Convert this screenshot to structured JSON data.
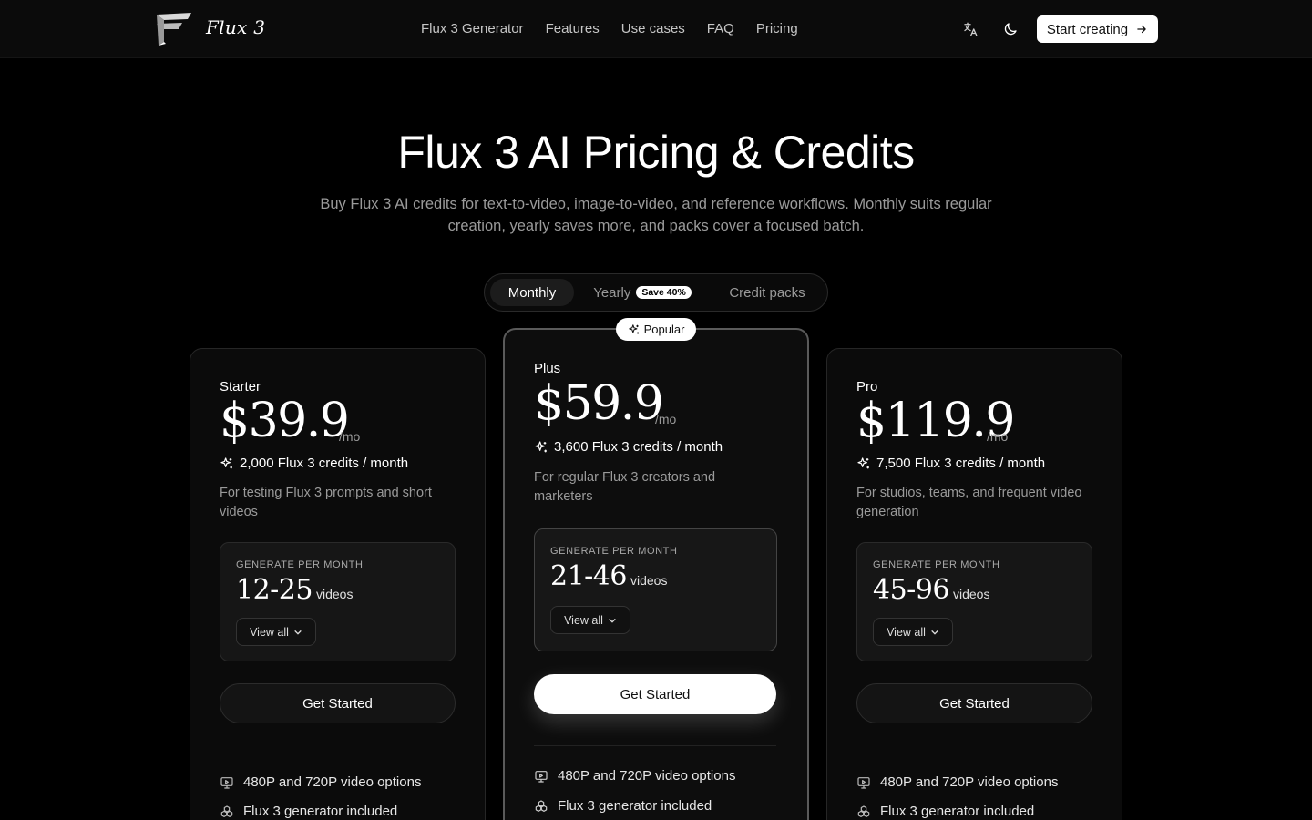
{
  "header": {
    "brand": "Flux 3",
    "nav": [
      "Flux 3 Generator",
      "Features",
      "Use cases",
      "FAQ",
      "Pricing"
    ],
    "cta_label": "Start creating",
    "icons": [
      "translate-icon",
      "moon-icon",
      "arrow-right-icon"
    ]
  },
  "hero": {
    "title": "Flux 3 AI Pricing & Credits",
    "subtitle": "Buy Flux 3 AI credits for text-to-video, image-to-video, and reference workflows. Monthly suits regular creation, yearly saves more, and packs cover a focused batch."
  },
  "billing_toggle": {
    "monthly": "Monthly",
    "yearly": "Yearly",
    "yearly_badge": "Save 40%",
    "packs": "Credit packs",
    "selected": "Monthly"
  },
  "popular_badge": "Popular",
  "plans": [
    {
      "name": "Starter",
      "price": "$39.9",
      "period": "/mo",
      "credits": "2,000 Flux 3 credits / month",
      "description": "For testing Flux 3 prompts and short videos",
      "gen_label": "GENERATE PER MONTH",
      "gen_range": "12-25",
      "gen_unit": "videos",
      "view_all": "View all",
      "button": "Get Started",
      "features": [
        "480P and 720P video options",
        "Flux 3 generator included"
      ]
    },
    {
      "name": "Plus",
      "price": "$59.9",
      "period": "/mo",
      "credits": "3,600 Flux 3 credits / month",
      "description": "For regular Flux 3 creators and marketers",
      "gen_label": "GENERATE PER MONTH",
      "gen_range": "21-46",
      "gen_unit": "videos",
      "view_all": "View all",
      "button": "Get Started",
      "features": [
        "480P and 720P video options",
        "Flux 3 generator included"
      ]
    },
    {
      "name": "Pro",
      "price": "$119.9",
      "period": "/mo",
      "credits": "7,500 Flux 3 credits / month",
      "description": "For studios, teams, and frequent video generation",
      "gen_label": "GENERATE PER MONTH",
      "gen_range": "45-96",
      "gen_unit": "videos",
      "view_all": "View all",
      "button": "Get Started",
      "features": [
        "480P and 720P video options",
        "Flux 3 generator included"
      ]
    }
  ]
}
